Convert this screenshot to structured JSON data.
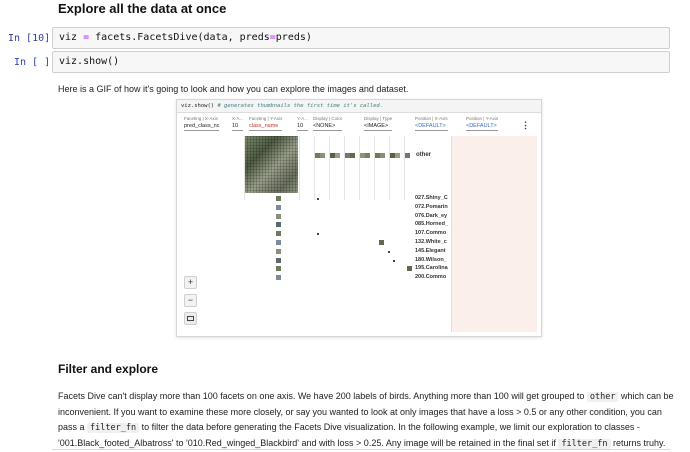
{
  "heading_top": "Explore all the data at once",
  "cells": [
    {
      "prompt": "In [10]:",
      "code_parts": [
        "viz ",
        "=",
        " facets.FacetsDive(data, preds",
        "=",
        "preds)"
      ]
    },
    {
      "prompt": "In [ ]:",
      "code_parts": [
        "viz.show()"
      ]
    }
  ],
  "intro_text": "Here is a GIF of how it's going to look and how you can explore the images and dataset.",
  "gif": {
    "code_line": "viz.show()",
    "code_comment": "# generates thumbnails the first time it's called.",
    "controls": [
      {
        "label": "Faceting | X-Axis",
        "value": "pred_class_nc"
      },
      {
        "label": "X-A...",
        "value": "10"
      },
      {
        "label": "Faceting | Y-Axis",
        "value": "class_name"
      },
      {
        "label": "Y-A...",
        "value": "10"
      },
      {
        "label": "Display | Color",
        "value": "<NONE>"
      },
      {
        "label": "Display | Type",
        "value": "<IMAGE>"
      },
      {
        "label": "Position | X-Axis",
        "value": "<DEFAULT>"
      },
      {
        "label": "Position | Y-Axis",
        "value": "<DEFAULT>"
      }
    ],
    "other_label": "other",
    "row_labels": [
      "027.Shiny_C",
      "072.Pomarin",
      "076.Dark_ey",
      "085.Horned_",
      "107.Commo",
      "132.White_c",
      "145.Elegant",
      "180.Wilson_",
      "195.Carolina",
      "200.Commo"
    ],
    "zoom_in": "+",
    "zoom_out": "−"
  },
  "section_heading": "Filter and explore",
  "paragraph": {
    "p1": "Facets Dive can't display more than 100 facets on one axis. We have 200 labels of birds. Anything more than 100 will get grouped to ",
    "code1": "other",
    "p2": " which can be inconvenient. If you want to examine these more closely, or say you wanted to look at only images that have a loss > 0.5 or any other condition, you can pass a ",
    "code2": "filter_fn",
    "p3": " to filter the data before generating the Facets Dive visualization. In the following example, we limit our exploration to classes - '001.Black_footed_Albatross' to '010.Red_winged_Blackbird' and with loss > 0.25. Any image will be retained in the final set if ",
    "code3": "filter_fn",
    "p4": " returns truhy."
  },
  "colors": {
    "prompt": "#303f9f",
    "operator": "#aa22ff",
    "panel_pink": "#fbefeb",
    "control_red": "#c0392b",
    "control_blue": "#3b6cc4"
  }
}
